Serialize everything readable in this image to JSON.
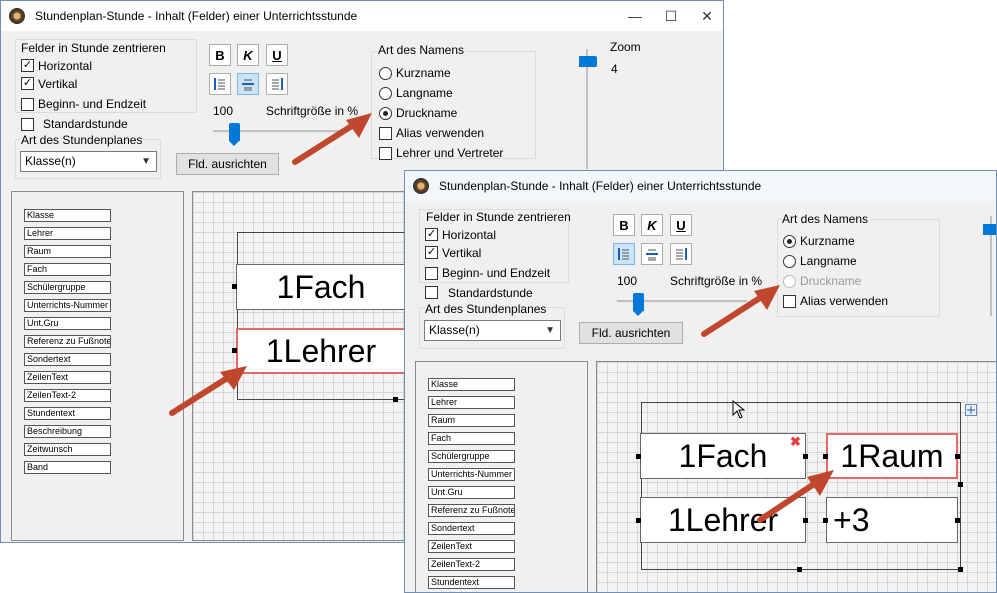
{
  "window_title": "Stundenplan-Stunde - Inhalt (Felder) einer Unterrichtsstunde",
  "window_controls": {
    "minimize": "—",
    "maximize": "☐",
    "close": "✕"
  },
  "center_group": {
    "title": "Felder in Stunde zentrieren",
    "horizontal": "Horizontal",
    "vertical": "Vertikal"
  },
  "options": {
    "begin_end": "Beginn- und Endzeit",
    "standard": "Standardstunde"
  },
  "plan_type": {
    "title": "Art des Stundenplanes",
    "selected": "Klasse(n)"
  },
  "format_buttons": {
    "bold": "B",
    "italic": "K",
    "underline": "U"
  },
  "font_size": {
    "value": "100",
    "label": "Schriftgröße in %"
  },
  "align_button": "Fld. ausrichten",
  "name_type": {
    "title": "Art des Namens",
    "short": "Kurzname",
    "long": "Langname",
    "print": "Druckname",
    "alias": "Alias verwenden",
    "teacher_sub": "Lehrer und Vertreter"
  },
  "zoom": {
    "label": "Zoom",
    "value": "4"
  },
  "fields_back": [
    "Klasse",
    "Lehrer",
    "Raum",
    "Fach",
    "Schülergruppe",
    "Unterrichts-Nummer",
    "Unt.Gru",
    "Referenz zu Fußnote",
    "Sondertext",
    "ZeilenText",
    "ZeilenText-2",
    "Stundentext",
    "Beschreibung",
    "Zeitwunsch",
    "Band"
  ],
  "fields_front": [
    "Klasse",
    "Lehrer",
    "Raum",
    "Fach",
    "Schülergruppe",
    "Unterrichts-Nummer",
    "Unt.Gru",
    "Referenz zu Fußnote",
    "Sondertext",
    "ZeilenText",
    "ZeilenText-2",
    "Stundentext"
  ],
  "cells_back": {
    "fach": "1Fach",
    "lehrer": "1Lehrer"
  },
  "cells_front": {
    "fach": "1Fach",
    "raum": "1Raum",
    "lehrer": "1Lehrer",
    "plus": "+3"
  },
  "colors": {
    "accent": "#0078d7",
    "arrow": "#c0462e",
    "selection": "#e06a6a"
  }
}
